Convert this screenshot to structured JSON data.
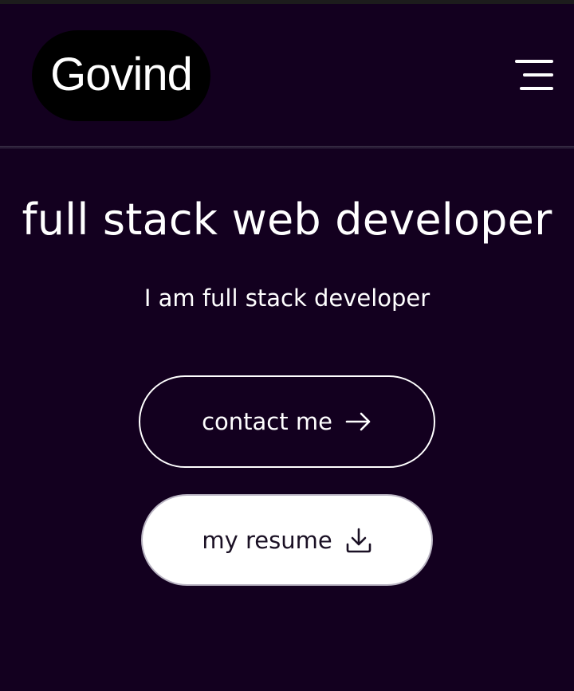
{
  "header": {
    "logo_text": "Govind",
    "menu_icon": "hamburger-menu-icon"
  },
  "hero": {
    "title": "full stack web developer",
    "subtitle": "I am full stack developer"
  },
  "buttons": {
    "contact": {
      "label": "contact me",
      "icon": "arrow-right-icon"
    },
    "resume": {
      "label": "my resume",
      "icon": "download-icon"
    }
  },
  "colors": {
    "background": "#13001f",
    "logo_background": "#000000",
    "text": "#ffffff",
    "resume_button_background": "#ffffff",
    "resume_button_text": "#1a1024"
  }
}
